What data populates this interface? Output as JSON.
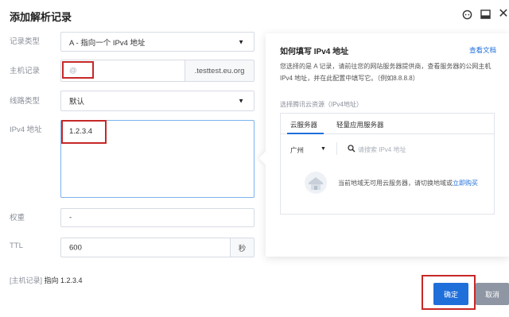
{
  "header": {
    "title": "添加解析记录"
  },
  "form": {
    "record_type": {
      "label": "记录类型",
      "value": "A - 指向一个 IPv4 地址"
    },
    "host": {
      "label": "主机记录",
      "placeholder": "@",
      "suffix": ".testtest.eu.org"
    },
    "line": {
      "label": "线路类型",
      "value": "默认"
    },
    "value": {
      "label": "IPv4 地址",
      "value": "1.2.3.4"
    },
    "weight": {
      "label": "权重",
      "value": "-"
    },
    "ttl": {
      "label": "TTL",
      "value": "600",
      "unit": "秒"
    }
  },
  "summary": {
    "key": "[主机记录]",
    "text": "指向  1.2.3.4"
  },
  "tip": {
    "title": "如何填写 IPv4 地址",
    "link": "查看文档",
    "desc_line1": "您选择的是 A 记录，请前往您的网站服务器提供商，查看服务器的公网主机",
    "desc_line2": "IPv4 地址，并在此配置中填写它。（例如8.8.8.8）",
    "sub": "选择腾讯云资源（IPv4地址）",
    "tabs": [
      "云服务器",
      "轻量应用服务器"
    ],
    "region": "广州",
    "search_placeholder": "请搜索 IPv4 地址",
    "empty_text": "当前地域无可用云服务器，请切换地域或",
    "empty_link": "立即购买"
  },
  "buttons": {
    "ok": "确定",
    "cancel": "取消"
  },
  "colors": {
    "accent": "#1f6fdb",
    "highlight": "#c62828"
  }
}
